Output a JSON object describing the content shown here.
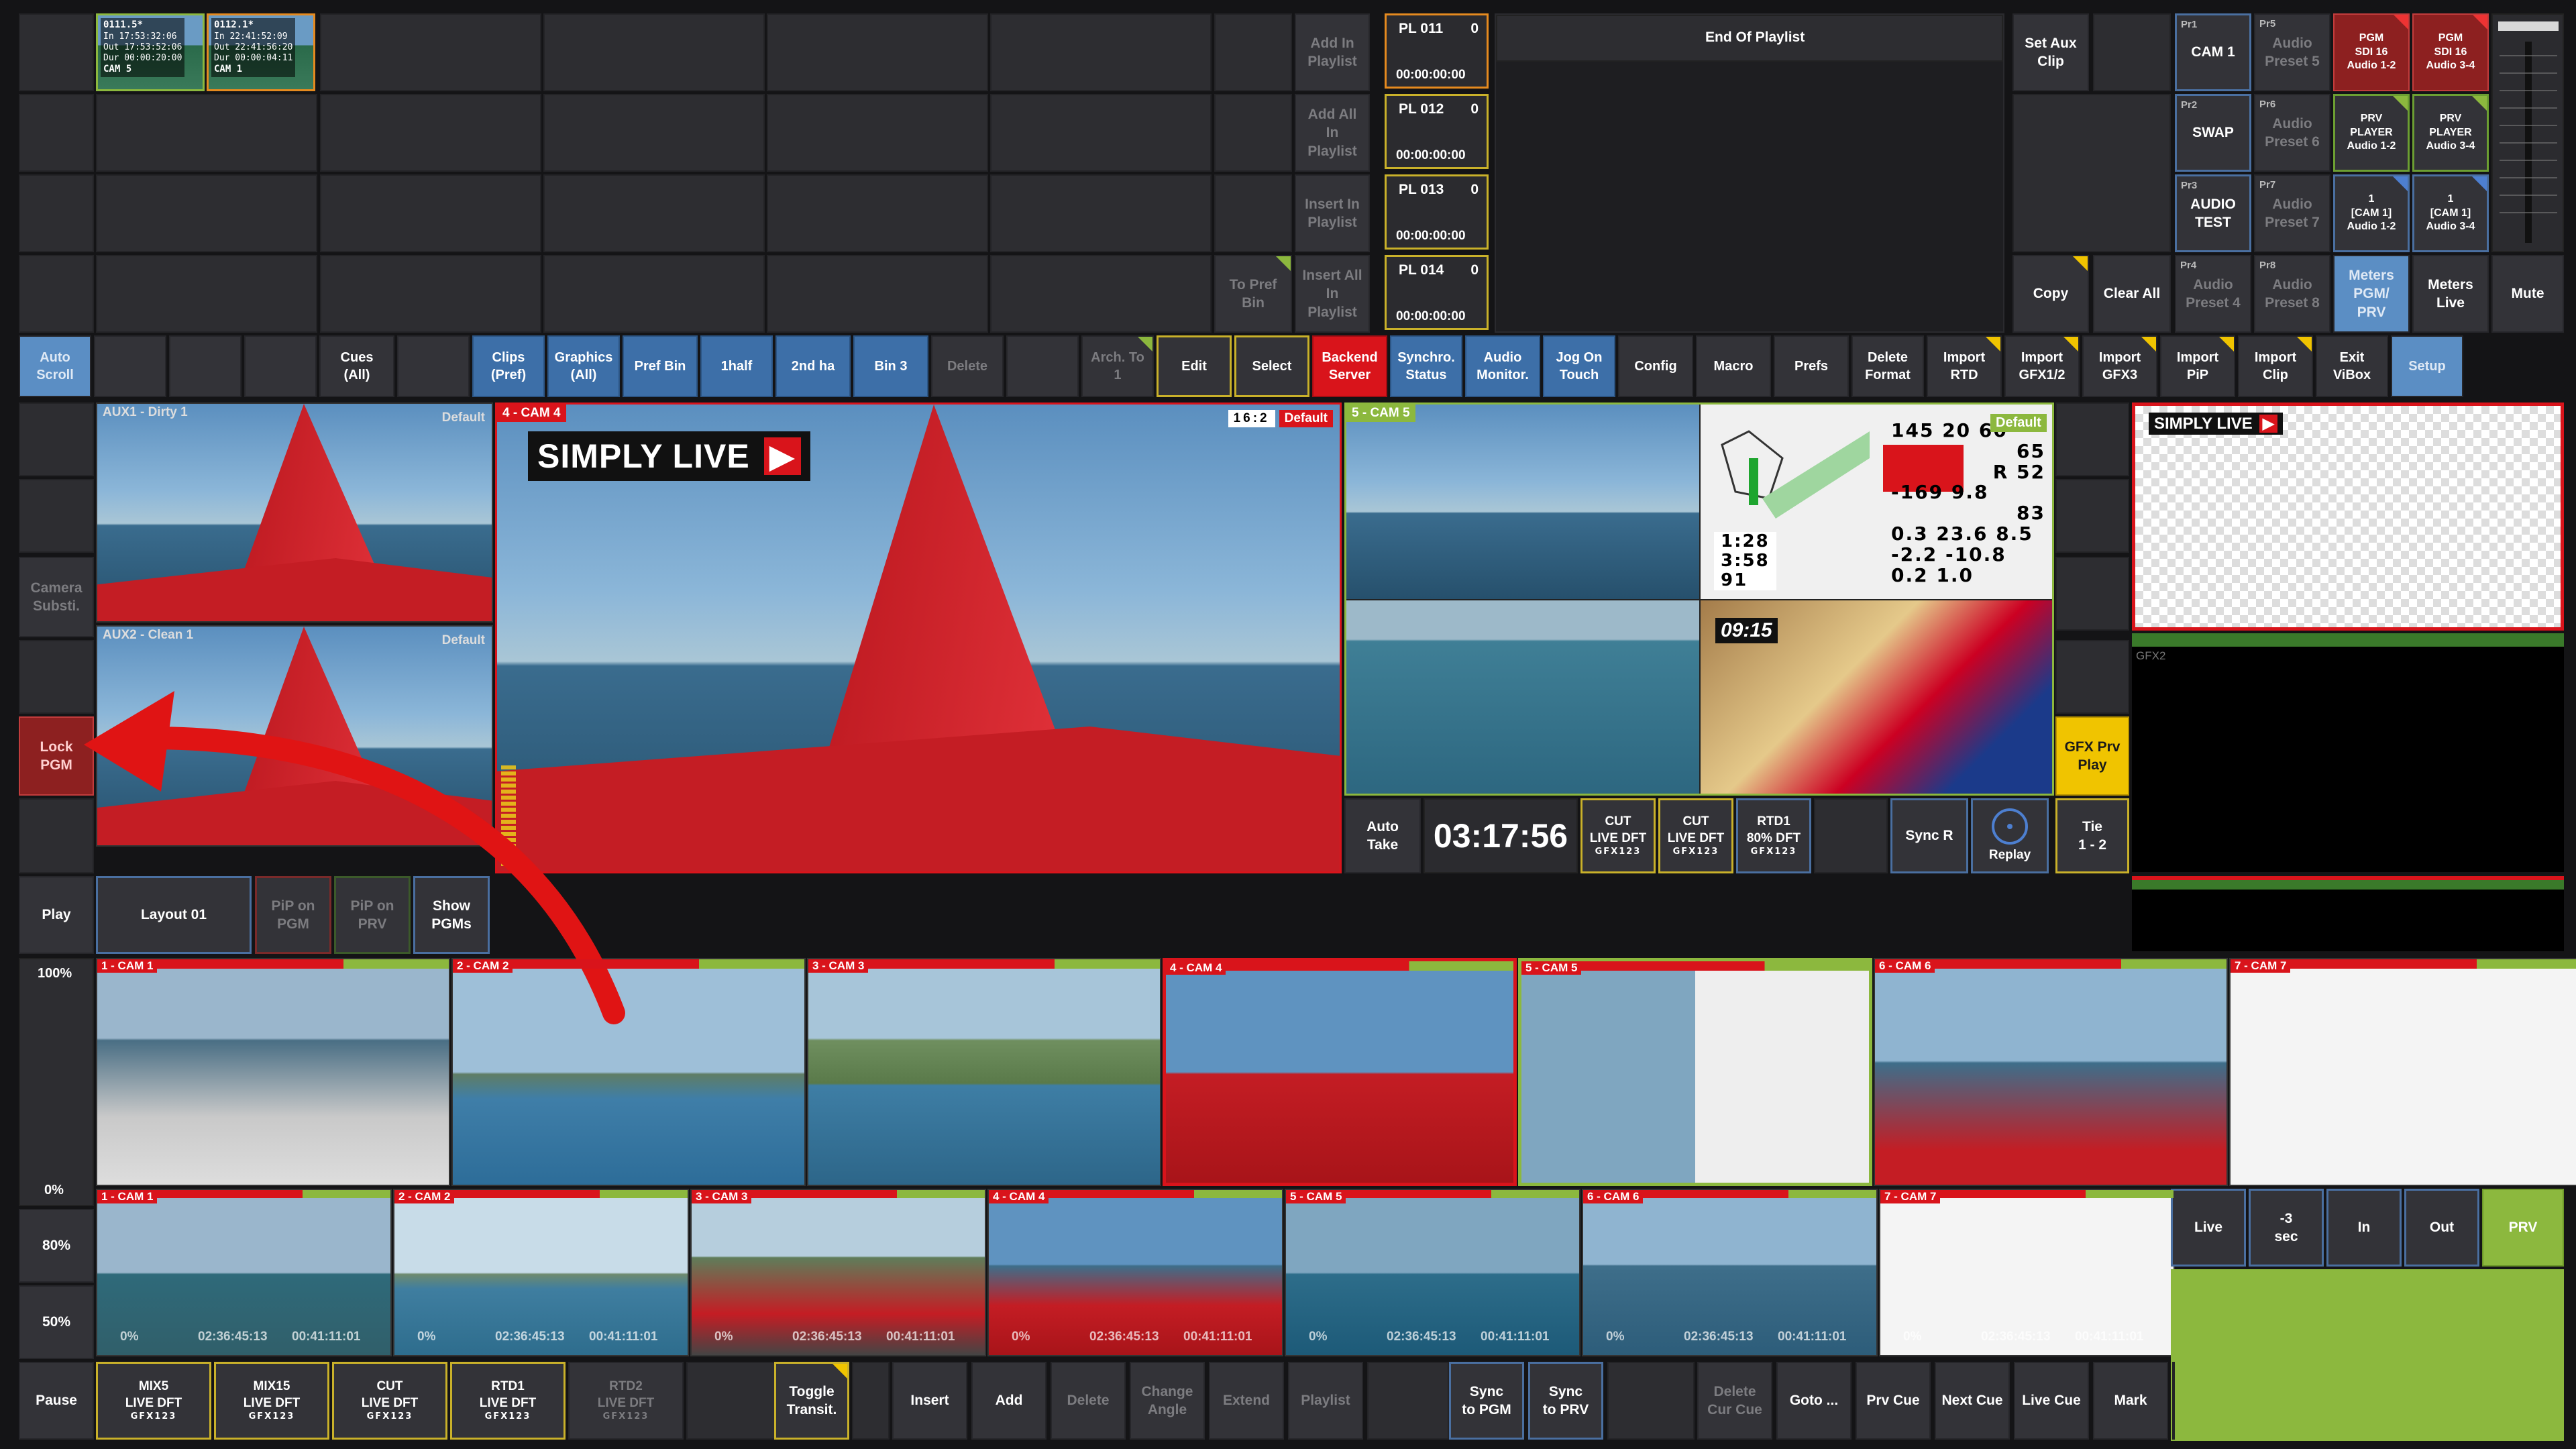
{
  "top_clips": [
    {
      "name": "0111.5*",
      "in": "In 17:53:32:06",
      "out": "Out 17:53:52:06",
      "dur": "Dur 00:00:20:00",
      "cam": "CAM 5"
    },
    {
      "name": "0112.1*",
      "in": "In 22:41:52:09",
      "out": "Out 22:41:56:20",
      "dur": "Dur 00:00:04:11",
      "cam": "CAM 1"
    }
  ],
  "playlist_actions": [
    "Add In\nPlaylist",
    "Add All\nIn\nPlaylist",
    "Insert In\nPlaylist",
    "Insert All\nIn\nPlaylist"
  ],
  "to_pref_bin": "To Pref\nBin",
  "playlists": [
    {
      "name": "PL 011",
      "count": "0",
      "time": "00:00:00:00"
    },
    {
      "name": "PL 012",
      "count": "0",
      "time": "00:00:00:00"
    },
    {
      "name": "PL 013",
      "count": "0",
      "time": "00:00:00:00"
    },
    {
      "name": "PL 014",
      "count": "0",
      "time": "00:00:00:00"
    }
  ],
  "end_of_playlist": "End Of Playlist",
  "set_aux_clip": "Set Aux\nClip",
  "copy": "Copy",
  "clear_all": "Clear All",
  "presets": [
    {
      "tag": "Pr1",
      "label": "CAM 1"
    },
    {
      "tag": "Pr5",
      "label": "Audio\nPreset 5"
    },
    {
      "tag": "Pr2",
      "label": "SWAP"
    },
    {
      "tag": "Pr6",
      "label": "Audio\nPreset 6"
    },
    {
      "tag": "Pr3",
      "label": "AUDIO\nTEST"
    },
    {
      "tag": "Pr7",
      "label": "Audio\nPreset 7"
    },
    {
      "tag": "Pr4",
      "label": "Audio\nPreset 4"
    },
    {
      "tag": "Pr8",
      "label": "Audio\nPreset 8"
    }
  ],
  "audio_routing": [
    "PGM\nSDI 16\nAudio 1-2",
    "PGM\nSDI 16\nAudio 3-4",
    "PRV\nPLAYER\nAudio 1-2",
    "PRV\nPLAYER\nAudio 3-4",
    "1\n[CAM 1]\nAudio 1-2",
    "1\n[CAM 1]\nAudio 3-4"
  ],
  "meters_pgm": "Meters\nPGM/\nPRV",
  "meters_live": "Meters\nLive",
  "mute": "Mute",
  "toolbar": [
    "Auto\nScroll",
    "",
    "",
    "",
    "Cues\n(All)",
    "",
    "Clips\n(Pref)",
    "Graphics\n(All)",
    "Pref Bin",
    "1half",
    "2nd ha",
    "Bin 3",
    "Delete",
    "",
    "Arch. To\n1",
    "Edit",
    "Select",
    "Backend\nServer",
    "Synchro.\nStatus",
    "Audio\nMonitor.",
    "Jog On\nTouch",
    "Config",
    "Macro",
    "Prefs",
    "Delete\nFormat",
    "Import\nRTD",
    "Import\nGFX1/2",
    "Import\nGFX3",
    "Import\nPiP",
    "Import\nClip",
    "Exit\nViBox",
    "Setup"
  ],
  "left_col": {
    "camera_subst": "Camera\nSubsti.",
    "lock_pgm": "Lock\nPGM",
    "play": "Play",
    "pct100": "100%",
    "pct0": "0%",
    "pct80": "80%",
    "pct50": "50%",
    "pause": "Pause"
  },
  "aux1": {
    "label": "AUX1 - Dirty 1",
    "badge": "Default"
  },
  "aux2": {
    "label": "AUX2 - Clean 1",
    "badge": "Default"
  },
  "main_view": {
    "label": "4 - CAM 4",
    "logo": "SIMPLY LIVE",
    "ratio": "16:2",
    "badge": "Default"
  },
  "cam5_quad": {
    "label": "5 - CAM 5"
  },
  "gfx_prv_play": "GFX Prv\nPlay",
  "auto_take": "Auto\nTake",
  "clock": "03:17:56",
  "transitions": [
    {
      "title": "CUT\nLIVE DFT",
      "gfx": "GFX123"
    },
    {
      "title": "CUT\nLIVE DFT",
      "gfx": "GFX123"
    },
    {
      "title": "RTD1\n80% DFT",
      "gfx": "GFX123"
    }
  ],
  "sync_r": "Sync R",
  "replay": "Replay",
  "tie": "Tie\n1 - 2",
  "layout": "Layout 01",
  "pip_pgm": "PiP on\nPGM",
  "pip_prv": "PiP on\nPRV",
  "show_pgms": "Show\nPGMs",
  "pgm_logo": "SIMPLY LIVE",
  "gfx2_label": "GFX2",
  "live_cams": [
    "1 - CAM 1",
    "2 - CAM 2",
    "3 - CAM 3",
    "4 - CAM 4",
    "5 - CAM 5",
    "6 - CAM 6",
    "7 - CAM 7"
  ],
  "replay_cams": [
    {
      "label": "1 - CAM 1",
      "pct": "0%",
      "tc": "02:36:45:13",
      "dur": "00:41:11:01"
    },
    {
      "label": "2 - CAM 2",
      "pct": "0%",
      "tc": "02:36:45:13",
      "dur": "00:41:11:01"
    },
    {
      "label": "3 - CAM 3",
      "pct": "0%",
      "tc": "02:36:45:13",
      "dur": "00:41:11:01"
    },
    {
      "label": "4 - CAM 4",
      "pct": "0%",
      "tc": "02:36:45:13",
      "dur": "00:41:11:01"
    },
    {
      "label": "5 - CAM 5",
      "pct": "0%",
      "tc": "02:36:45:13",
      "dur": "00:41:11:01"
    },
    {
      "label": "6 - CAM 6",
      "pct": "0%",
      "tc": "02:36:45:13",
      "dur": "00:41:11:01"
    },
    {
      "label": "7 - CAM 7",
      "pct": "0%",
      "tc": "02:36:45:13",
      "dur": "00:41:11:01"
    }
  ],
  "transport": [
    "Live",
    "-3\nsec",
    "In",
    "Out",
    "PRV"
  ],
  "bottom_mix": [
    {
      "title": "MIX5\nLIVE DFT",
      "gfx": "GFX123"
    },
    {
      "title": "MIX15\nLIVE DFT",
      "gfx": "GFX123"
    },
    {
      "title": "CUT\nLIVE DFT",
      "gfx": "GFX123"
    },
    {
      "title": "RTD1\nLIVE DFT",
      "gfx": "GFX123"
    },
    {
      "title": "RTD2\nLIVE DFT",
      "gfx": "GFX123"
    }
  ],
  "toggle_transit": "Toggle\nTransit.",
  "bottom_actions": [
    "Insert",
    "Add",
    "Delete",
    "Change\nAngle",
    "Extend",
    "Playlist"
  ],
  "sync_pgm": "Sync\nto PGM",
  "sync_prv": "Sync\nto PRV",
  "cue_actions": [
    "Delete\nCur Cue",
    "Goto ...",
    "Prv Cue",
    "Next Cue",
    "Live Cue",
    "Mark"
  ],
  "stats": {
    "a": "65",
    "b": "R 52",
    "c": "-169",
    "d": "9.8",
    "e": "83",
    "f": "0.3",
    "g": "23.6",
    "h": "8.5",
    "i": "-2.2",
    "j": "-10.8",
    "k": "0.2",
    "l": "1.0",
    "m": "1:28",
    "n": "3:58",
    "o": "91",
    "p": "09:15",
    "q": "145",
    "r": "20",
    "s": "60"
  },
  "colors": {
    "accent_blue": "#3d6fa8",
    "red": "#d9141b",
    "yellow": "#f0c400",
    "green": "#8cb83e"
  }
}
